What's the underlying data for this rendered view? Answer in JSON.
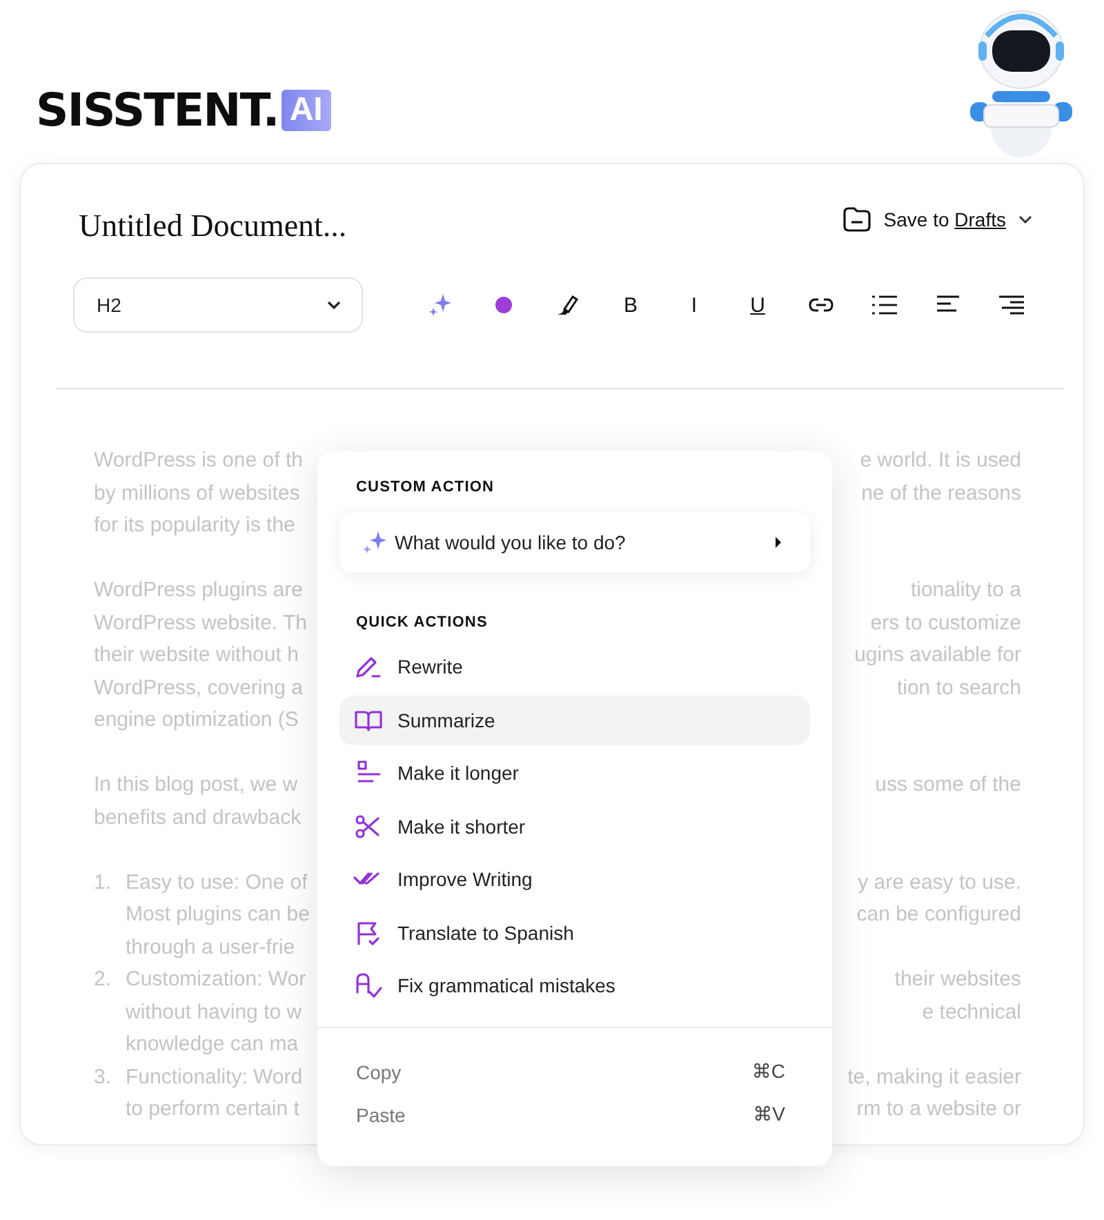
{
  "logo": {
    "wordmark": "SISSTENT.",
    "badge": "AI"
  },
  "document": {
    "title": "Untitled Document...",
    "save_prefix": "Save to",
    "save_target": "Drafts"
  },
  "toolbar": {
    "block_style": "H2",
    "tools": [
      {
        "kind": "sparkle"
      },
      {
        "kind": "color",
        "color": "#9b3fd6"
      },
      {
        "kind": "highlight"
      },
      {
        "kind": "bold",
        "label": "B"
      },
      {
        "kind": "italic",
        "label": "I"
      },
      {
        "kind": "underline",
        "label": "U"
      },
      {
        "kind": "link"
      },
      {
        "kind": "list"
      },
      {
        "kind": "align-left"
      },
      {
        "kind": "align-right"
      }
    ]
  },
  "body": [
    {
      "lines": [
        {
          "left": "WordPress is one of th",
          "right": "e world. It is used"
        },
        {
          "left": "by millions of websites",
          "right": "ne of the reasons"
        },
        {
          "left": "for its popularity is the"
        }
      ]
    },
    {
      "lines": [
        {
          "left": "WordPress plugins are",
          "right": "tionality to a"
        },
        {
          "left": "WordPress website. Th",
          "right": "ers to customize"
        },
        {
          "left": "their website without h",
          "right": "ugins available for"
        },
        {
          "left": "WordPress, covering a",
          "right": "tion to search"
        },
        {
          "left": "engine optimization (S"
        }
      ]
    },
    {
      "lines": [
        {
          "left": "In this blog post, we w",
          "right": "uss some of the"
        },
        {
          "left": "benefits and drawback"
        }
      ]
    },
    {
      "number": "1.",
      "lines": [
        {
          "left": "Easy to use: One of",
          "right": "y are easy to use."
        },
        {
          "left": "Most plugins can be",
          "right": "can be configured"
        },
        {
          "left": "through a user-frie"
        }
      ]
    },
    {
      "number": "2.",
      "lines": [
        {
          "left": "Customization: Wor",
          "right": "their websites"
        },
        {
          "left": "without having to w",
          "right": "e technical"
        },
        {
          "left": "knowledge can ma"
        }
      ]
    },
    {
      "number": "3.",
      "lines": [
        {
          "left": "Functionality: Word",
          "right": "te, making it easier"
        },
        {
          "left": "to perform certain t",
          "right": "rm to a website or"
        }
      ]
    }
  ],
  "menu": {
    "custom_heading": "CUSTOM ACTION",
    "prompt": "What would you like to do?",
    "quick_heading": "QUICK ACTIONS",
    "actions": [
      {
        "kind": "pencil",
        "label": "Rewrite",
        "selected": false
      },
      {
        "kind": "book",
        "label": "Summarize",
        "selected": true
      },
      {
        "kind": "lengthen",
        "label": "Make it longer",
        "selected": false
      },
      {
        "kind": "scissors",
        "label": "Make it shorter",
        "selected": false
      },
      {
        "kind": "checks",
        "label": "Improve Writing",
        "selected": false
      },
      {
        "kind": "flag",
        "label": "Translate to Spanish",
        "selected": false
      },
      {
        "kind": "spellcheck",
        "label": "Fix grammatical mistakes",
        "selected": false
      }
    ],
    "clipboard": [
      {
        "label": "Copy",
        "shortcut": "⌘C"
      },
      {
        "label": "Paste",
        "shortcut": "⌘V"
      }
    ]
  }
}
